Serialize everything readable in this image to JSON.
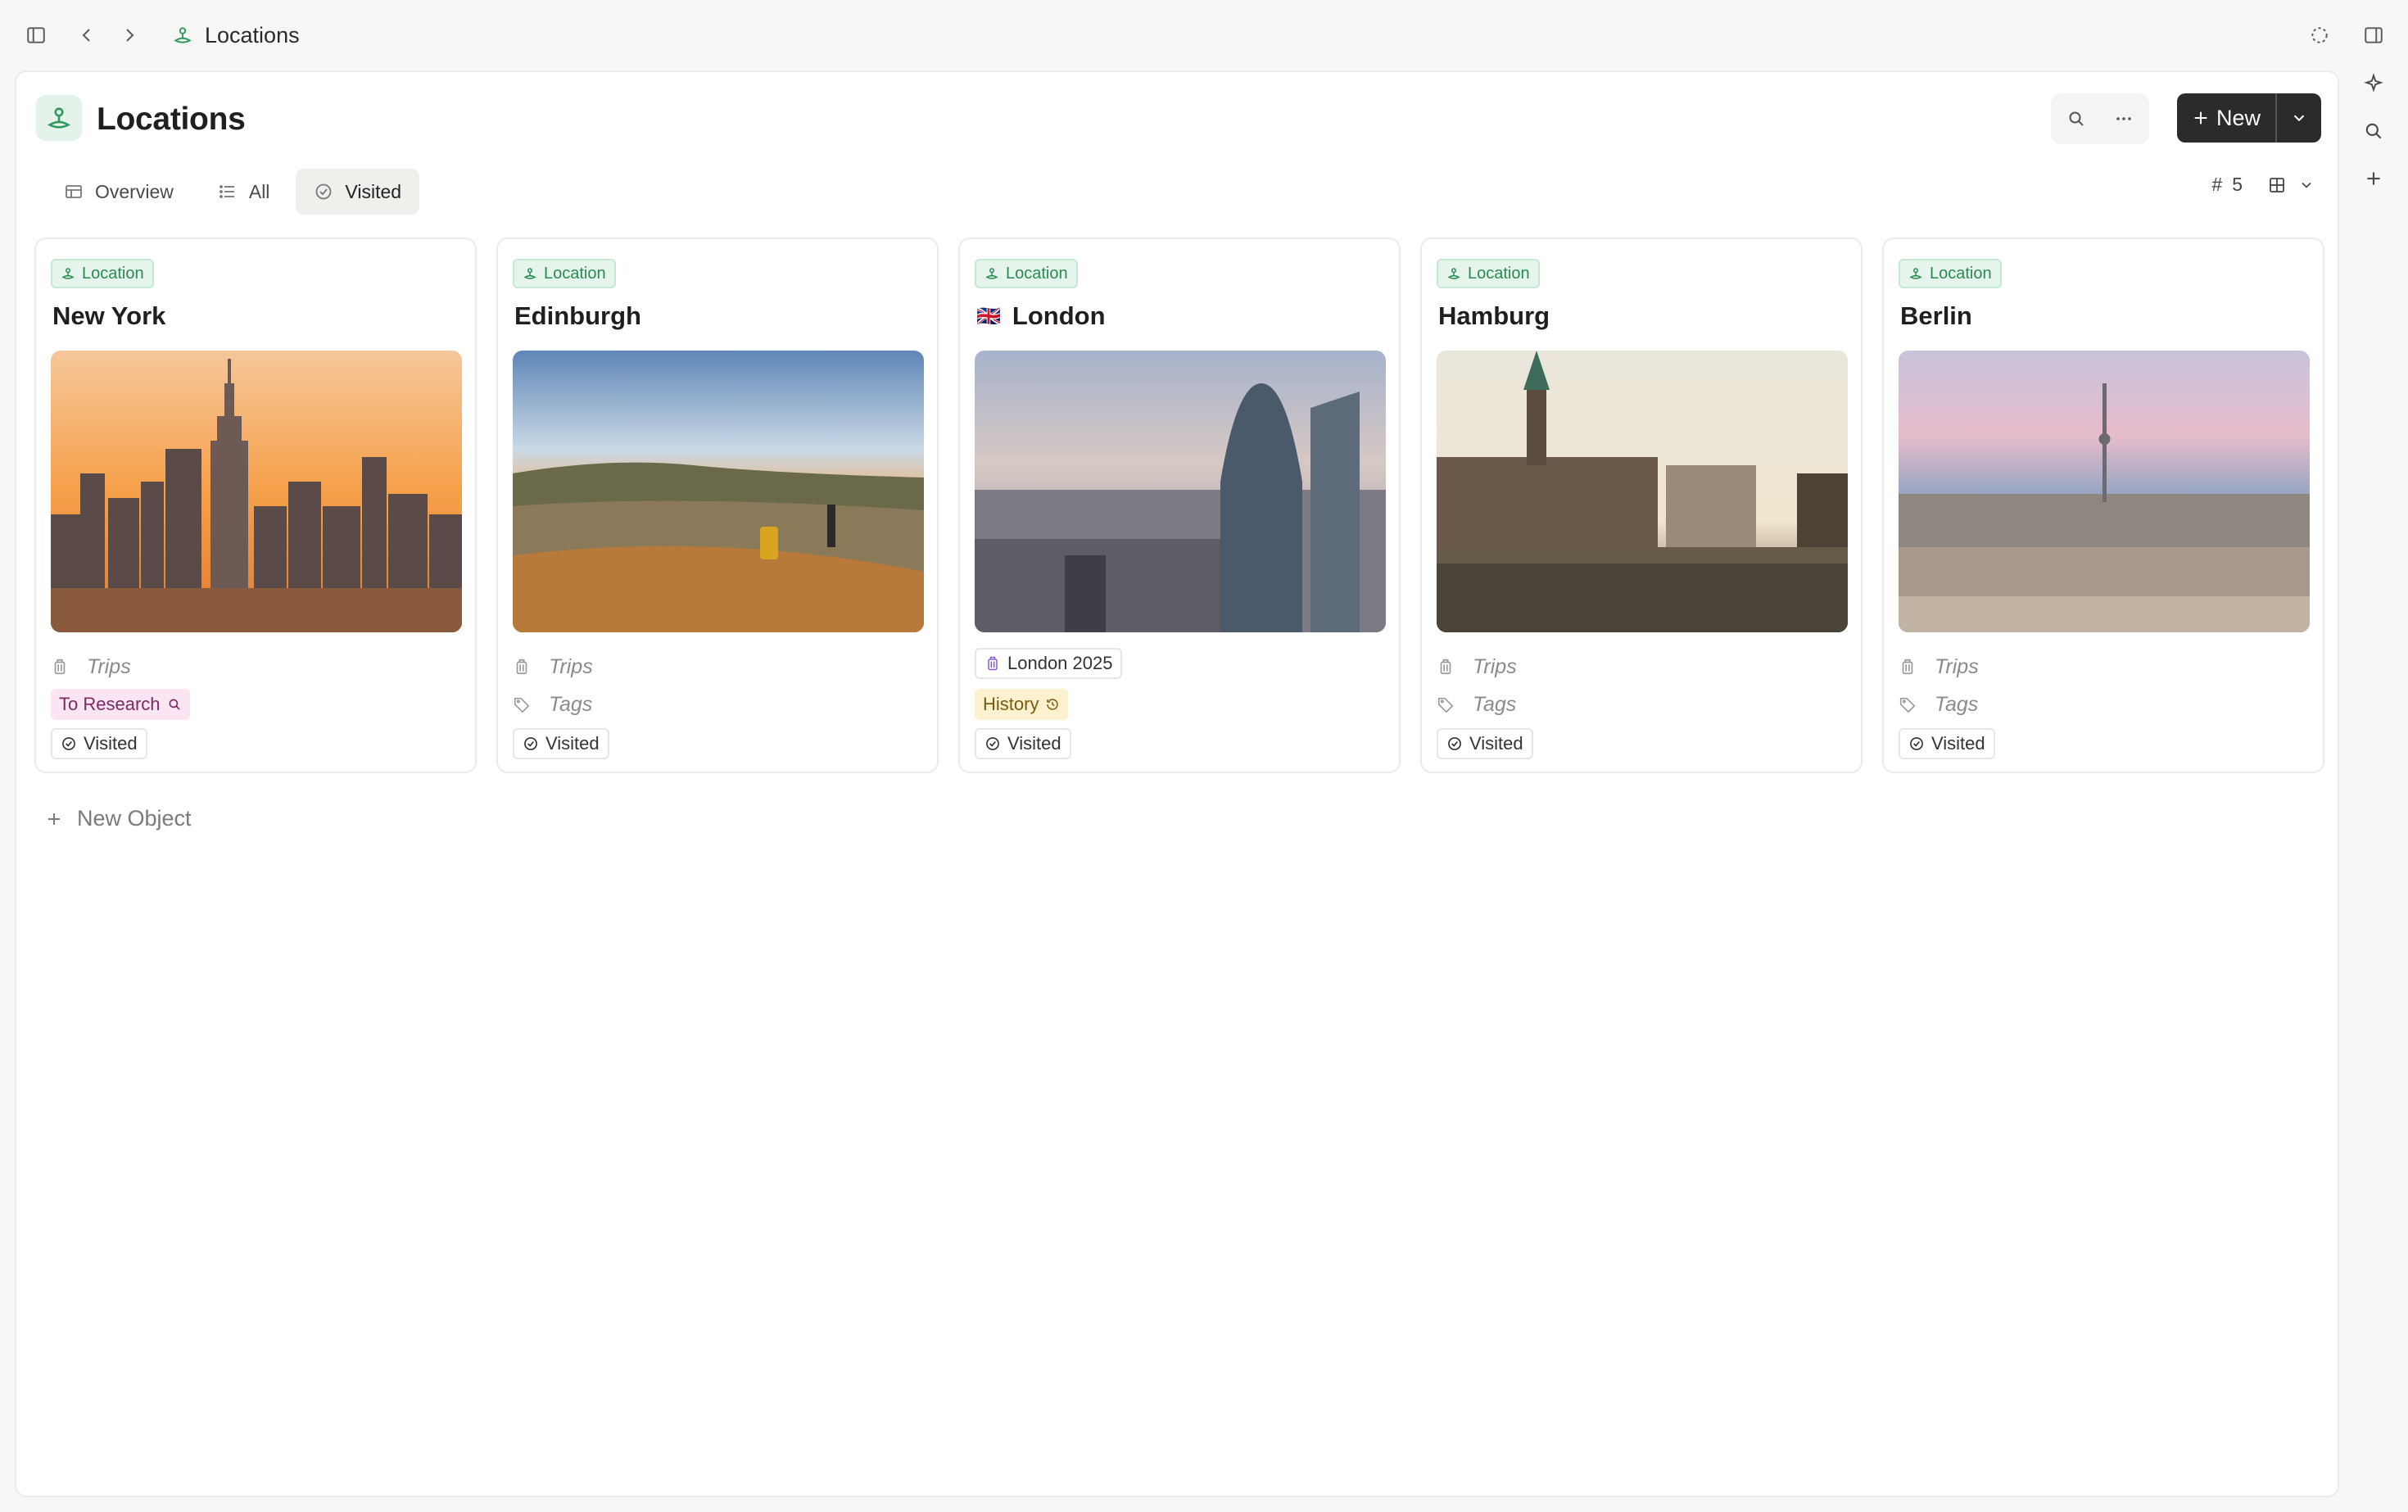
{
  "breadcrumb": {
    "label": "Locations"
  },
  "header": {
    "title": "Locations",
    "new_label": "New"
  },
  "tabs": [
    {
      "label": "Overview",
      "icon": "table-icon"
    },
    {
      "label": "All",
      "icon": "list-icon"
    },
    {
      "label": "Visited",
      "icon": "check-circle-icon",
      "active": true
    }
  ],
  "view": {
    "count_symbol": "#",
    "count": "5"
  },
  "cards": [
    {
      "type": "Location",
      "title": "New York",
      "flag": "",
      "trips": "Trips",
      "tag": "To Research",
      "tag_style": "pink",
      "status": "Visited"
    },
    {
      "type": "Location",
      "title": "Edinburgh",
      "flag": "",
      "trips": "Trips",
      "tag": "Tags",
      "tag_style": "empty",
      "status": "Visited"
    },
    {
      "type": "Location",
      "title": "London",
      "flag": "🇬🇧",
      "trips": "London 2025",
      "trips_filled": true,
      "tag": "History",
      "tag_style": "yellow",
      "status": "Visited"
    },
    {
      "type": "Location",
      "title": "Hamburg",
      "flag": "",
      "trips": "Trips",
      "tag": "Tags",
      "tag_style": "empty",
      "status": "Visited"
    },
    {
      "type": "Location",
      "title": "Berlin",
      "flag": "",
      "trips": "Trips",
      "tag": "Tags",
      "tag_style": "empty",
      "status": "Visited"
    }
  ],
  "new_object_label": "New Object",
  "colors": {
    "accent_green": "#2f9a5c",
    "dark_button": "#2b2b2b",
    "pink_chip": "#fbe5f3",
    "yellow_chip": "#fdf1cf"
  }
}
